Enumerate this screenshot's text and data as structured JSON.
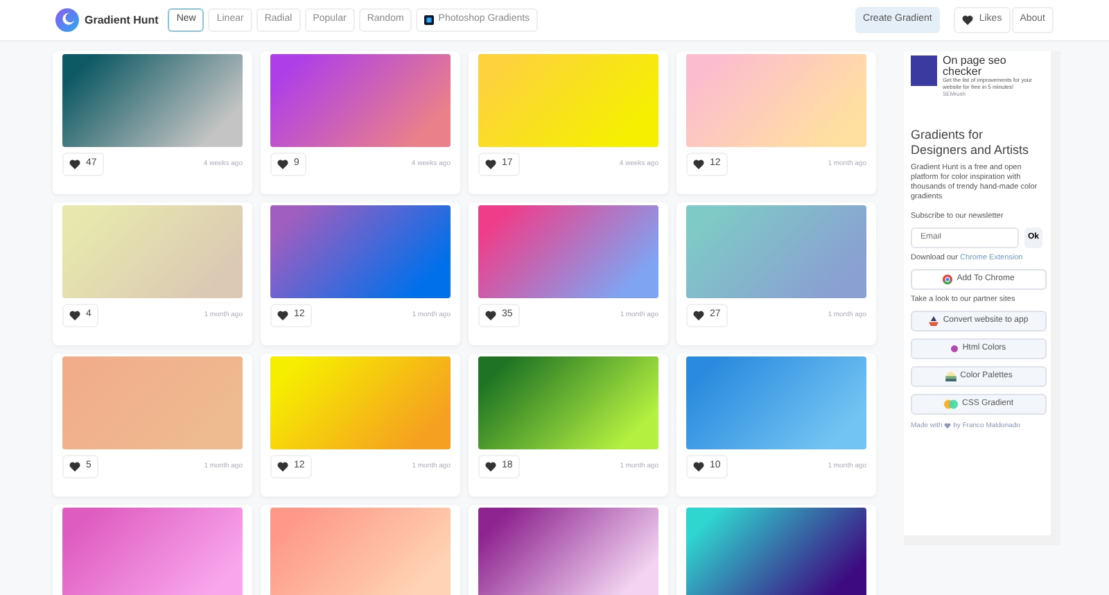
{
  "brand": "Gradient Hunt",
  "tabs": [
    {
      "label": "New",
      "selected": true,
      "kind": "plain"
    },
    {
      "label": "Linear",
      "selected": false,
      "kind": "plain"
    },
    {
      "label": "Radial",
      "selected": false,
      "kind": "plain"
    },
    {
      "label": "Popular",
      "selected": false,
      "kind": "plain"
    },
    {
      "label": "Random",
      "selected": false,
      "kind": "plain"
    },
    {
      "label": "Photoshop Gradients",
      "selected": false,
      "kind": "photoshop"
    }
  ],
  "actions": {
    "create": "Create Gradient",
    "likes": "Likes",
    "about": "About"
  },
  "gradients": [
    {
      "stops": [
        {
          "color": "#0e5a64"
        },
        {
          "color": "#c4c4c4"
        }
      ],
      "likes": "47",
      "time": "4 weeks ago"
    },
    {
      "stops": [
        {
          "color": "#ae3fe8"
        },
        {
          "color": "#e9808a"
        }
      ],
      "likes": "9",
      "time": "4 weeks ago"
    },
    {
      "stops": [
        {
          "color": "#fdd23c"
        },
        {
          "color": "#f5f000"
        }
      ],
      "likes": "17",
      "time": "4 weeks ago"
    },
    {
      "stops": [
        {
          "color": "#fcbccf"
        },
        {
          "color": "#ffe0a0"
        }
      ],
      "likes": "12",
      "time": "1 month ago"
    },
    {
      "stops": [
        {
          "color": "#e7e8ad"
        },
        {
          "color": "#dbc9b4"
        }
      ],
      "likes": "4",
      "time": "1 month ago"
    },
    {
      "stops": [
        {
          "color": "#a05ec0"
        },
        {
          "color": "#0070ea"
        }
      ],
      "likes": "12",
      "time": "1 month ago"
    },
    {
      "stops": [
        {
          "color": "#ef3d8a"
        },
        {
          "color": "#7fa4f2"
        }
      ],
      "likes": "35",
      "time": "1 month ago"
    },
    {
      "stops": [
        {
          "color": "#7ecac6"
        },
        {
          "color": "#8a9fd2"
        }
      ],
      "likes": "27",
      "time": "1 month ago"
    },
    {
      "stops": [
        {
          "color": "#f1ad8a"
        },
        {
          "color": "#eebb90"
        }
      ],
      "likes": "5",
      "time": "1 month ago"
    },
    {
      "stops": [
        {
          "color": "#f6ee00"
        },
        {
          "color": "#f5a020"
        }
      ],
      "likes": "12",
      "time": "1 month ago"
    },
    {
      "stops": [
        {
          "color": "#1e7424"
        },
        {
          "color": "#b4f040"
        }
      ],
      "likes": "18",
      "time": "1 month ago"
    },
    {
      "stops": [
        {
          "color": "#2a8ade"
        },
        {
          "color": "#72c4f2"
        }
      ],
      "likes": "10",
      "time": "1 month ago"
    },
    {
      "stops": [
        {
          "color": "#de5cc0"
        },
        {
          "color": "#f9a6ec"
        }
      ]
    },
    {
      "stops": [
        {
          "color": "#ff9888"
        },
        {
          "color": "#ffd4b4"
        }
      ]
    },
    {
      "stops": [
        {
          "color": "#8e2490"
        },
        {
          "color": "#f2d4f2"
        }
      ]
    },
    {
      "stops": [
        {
          "color": "#2fd6d0"
        },
        {
          "color": "#3e0a80"
        }
      ]
    }
  ],
  "sidebar": {
    "ad": {
      "title": "On page seo checker",
      "text": "Get the list of improvements for your website for free in 5 minutes!",
      "source": "SEMrush"
    },
    "heading": "Gradients for Designers and Artists",
    "about": "Gradient Hunt is a free and open platform for color inspiration with thousands of trendy hand-made color gradients",
    "newsletter_label": "Subscribe to our newsletter",
    "email": {
      "placeholder": "Email"
    },
    "ok": "Ok",
    "download_text": "Download our",
    "download_link": "Chrome Extension",
    "chrome_button": "Add To Chrome",
    "partners_label": "Take a look to our partner sites",
    "partners": [
      {
        "label": "Convert website to app",
        "kind": "app"
      },
      {
        "label": "Html Colors",
        "kind": "dot"
      },
      {
        "label": "Color Palettes",
        "kind": "palette"
      },
      {
        "label": "CSS Gradient",
        "kind": "circles"
      }
    ],
    "made_with": "Made with",
    "made_by": "by Franco Maldonado"
  }
}
